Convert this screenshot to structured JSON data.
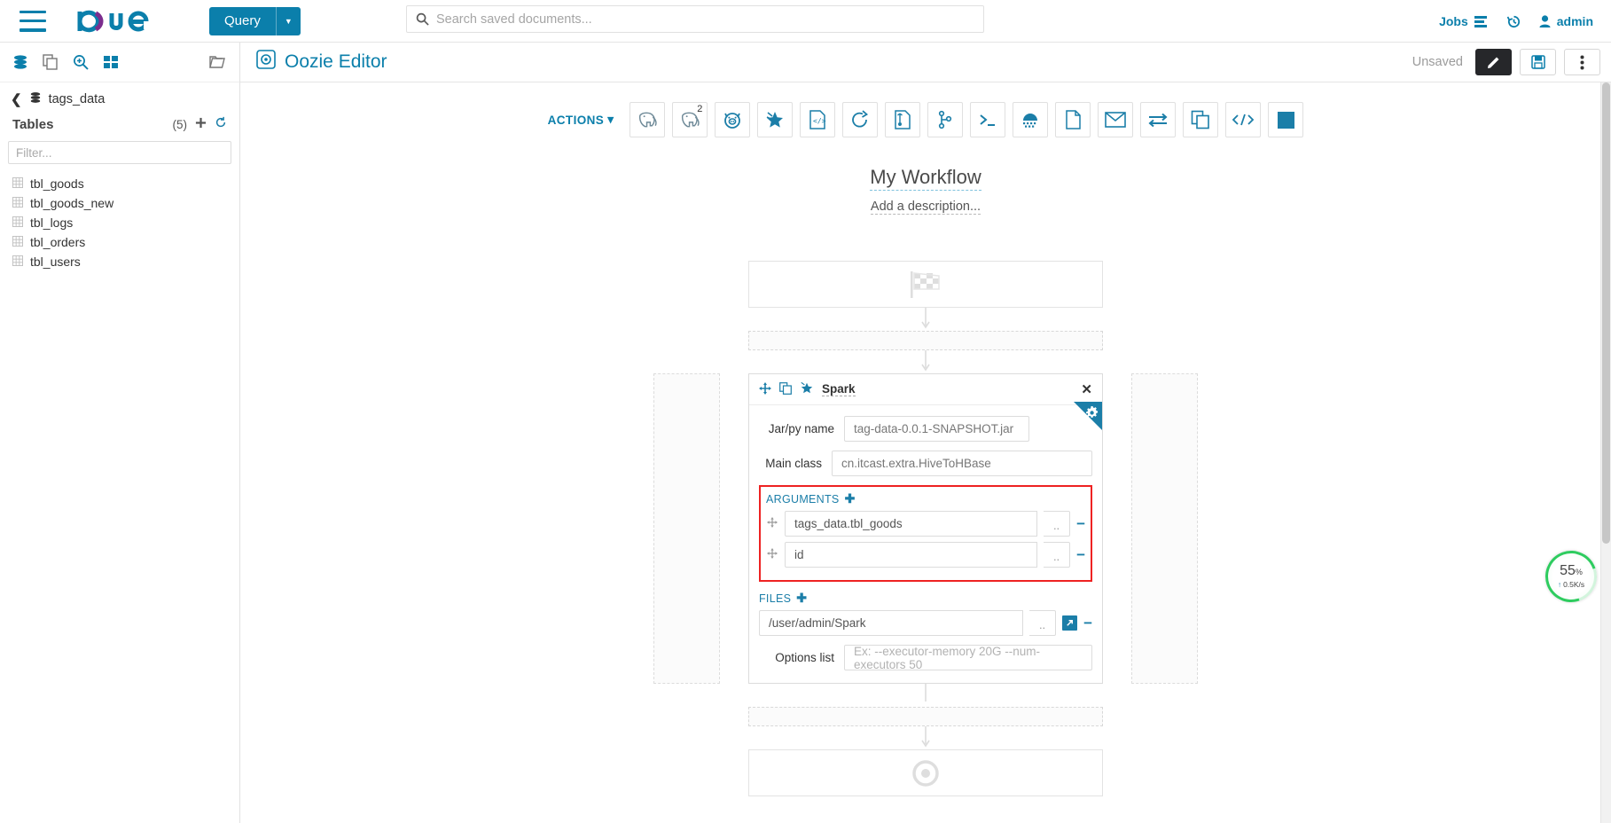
{
  "topnav": {
    "menu_icon": "hamburger-icon",
    "logo_text": "hue",
    "query_label": "Query",
    "search_placeholder": "Search saved documents...",
    "jobs_label": "Jobs",
    "history_icon": "history-icon",
    "user_label": "admin"
  },
  "left_panel": {
    "icons": [
      "database-icon",
      "copy-icon",
      "search-plus-icon",
      "grid-icon",
      "folder-icon"
    ],
    "database": "tags_data",
    "tables_label": "Tables",
    "tables_count": "(5)",
    "add_icon": "plus-icon",
    "refresh_icon": "refresh-icon",
    "filter_placeholder": "Filter...",
    "tables": [
      {
        "name": "tbl_goods"
      },
      {
        "name": "tbl_goods_new"
      },
      {
        "name": "tbl_logs"
      },
      {
        "name": "tbl_orders"
      },
      {
        "name": "tbl_users"
      }
    ]
  },
  "page_header": {
    "title": "Oozie Editor",
    "status": "Unsaved",
    "edit_icon": "pencil-icon",
    "save_icon": "floppy-disk-icon",
    "more_icon": "vertical-ellipsis-icon"
  },
  "toolbar": {
    "actions_label": "ACTIONS",
    "buttons": [
      {
        "icon": "hive-elephant-icon",
        "badge": ""
      },
      {
        "icon": "hive-elephant-icon",
        "badge": "2"
      },
      {
        "icon": "pig-icon",
        "badge": ""
      },
      {
        "icon": "spark-star-icon",
        "badge": ""
      },
      {
        "icon": "java-code-file-icon",
        "badge": ""
      },
      {
        "icon": "sqoop-circle-icon",
        "badge": ""
      },
      {
        "icon": "distcp-file-icon",
        "badge": ""
      },
      {
        "icon": "fork-branch-icon",
        "badge": ""
      },
      {
        "icon": "shell-prompt-icon",
        "badge": ""
      },
      {
        "icon": "ssh-icon",
        "badge": ""
      },
      {
        "icon": "fs-file-icon",
        "badge": ""
      },
      {
        "icon": "email-envelope-icon",
        "badge": ""
      },
      {
        "icon": "sub-workflow-arrows-icon",
        "badge": ""
      },
      {
        "icon": "copy-documents-icon",
        "badge": ""
      },
      {
        "icon": "xml-code-icon",
        "badge": ""
      },
      {
        "icon": "stop-square-icon",
        "badge": ""
      }
    ]
  },
  "workflow": {
    "title": "My Workflow",
    "description": "Add a description...",
    "start_node_icon": "checkered-flag-icon",
    "end_node_icon": "target-circle-icon"
  },
  "spark_node": {
    "move_icon": "move-arrows-icon",
    "copy_icon": "copy-icon",
    "type_icon": "spark-star-icon",
    "name": "Spark",
    "close_icon": "close-icon",
    "settings_icon": "gears-icon",
    "fields": [
      {
        "label": "Jar/py name",
        "value": "tag-data-0.0.1-SNAPSHOT.jar",
        "placeholder": ""
      },
      {
        "label": "Main class",
        "value": "cn.itcast.extra.HiveToHBase",
        "placeholder": ""
      }
    ],
    "arguments": {
      "title": "ARGUMENTS",
      "add_icon": "plus-icon",
      "highlight_color": "#ee2222",
      "items": [
        {
          "value": "tags_data.tbl_goods",
          "browse_label": "..",
          "remove_icon": "minus-icon"
        },
        {
          "value": "id",
          "browse_label": "..",
          "remove_icon": "minus-icon"
        }
      ]
    },
    "files": {
      "title": "FILES",
      "add_icon": "plus-icon",
      "items": [
        {
          "value": "/user/admin/Spark",
          "browse_label": "..",
          "open_icon": "external-link-icon",
          "remove_icon": "minus-icon"
        }
      ]
    },
    "options": {
      "label": "Options list",
      "value": "",
      "placeholder": "Ex: --executor-memory 20G --num-executors 50"
    }
  },
  "speed_widget": {
    "percent": "55",
    "percent_symbol": "%",
    "rate": "0.5K/s",
    "arrow_icon": "arrow-up-icon",
    "accent": "#2ecc5f"
  }
}
